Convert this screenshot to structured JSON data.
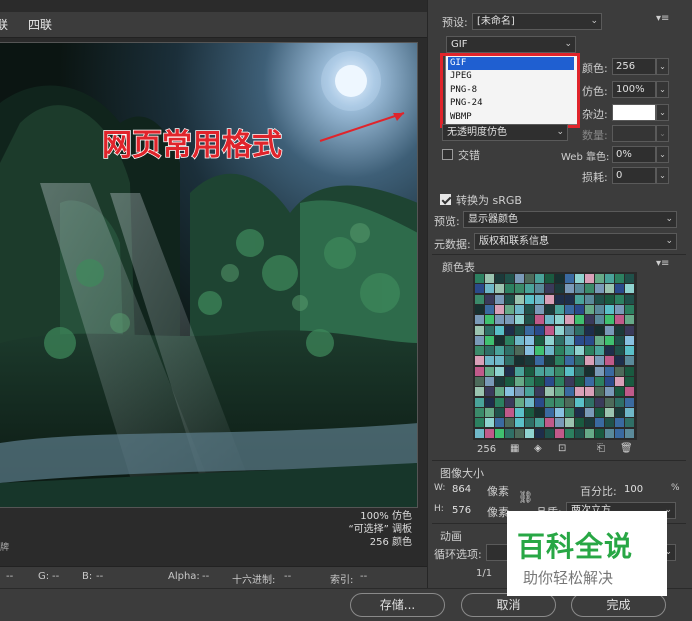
{
  "tabs": [
    "联",
    "四联"
  ],
  "annotation": {
    "text": "网页常用格式",
    "color": "#e0242b"
  },
  "image_info": [
    "100% 仿色",
    "“可选择” 调板",
    "256 颜色"
  ],
  "left_bottom_mark": "牌",
  "status": {
    "r": "--",
    "g_label": "G:",
    "g": "--",
    "b_label": "B:",
    "b": "--",
    "alpha_label": "Alpha:",
    "alpha": "--",
    "hex_label": "十六进制:",
    "hex": "--",
    "index_label": "索引:",
    "index": "--"
  },
  "actions": {
    "save": "存储...",
    "cancel": "取消",
    "done": "完成"
  },
  "preset": {
    "label": "预设:",
    "value": "[未命名]"
  },
  "format": {
    "selected": "GIF",
    "options": [
      "GIF",
      "JPEG",
      "PNG-8",
      "PNG-24",
      "WBMP"
    ]
  },
  "settings": {
    "colors_label": "颜色:",
    "colors_value": "256",
    "dither_label": "仿色:",
    "dither_value": "100%",
    "matte_label": "杂边:",
    "transparency_dither": "无透明度仿色",
    "amount_label": "数量:",
    "interlaced_label": "交错",
    "web_snap_label": "Web 靠色:",
    "web_snap_value": "0%",
    "lossy_label": "损耗:",
    "lossy_value": "0"
  },
  "convert_srgb": "转换为 sRGB",
  "preview": {
    "label": "预览:",
    "value": "显示器颜色"
  },
  "metadata": {
    "label": "元数据:",
    "value": "版权和联系信息"
  },
  "color_table": {
    "title": "颜色表",
    "count": "256"
  },
  "image_size": {
    "title": "图像大小",
    "w_label": "W:",
    "w_value": "864",
    "w_unit": "像素",
    "h_label": "H:",
    "h_value": "576",
    "h_unit": "像素",
    "percent_label": "百分比:",
    "percent_value": "100",
    "percent_unit": "%",
    "quality_label": "品质:",
    "quality_value": "两次立方"
  },
  "animation": {
    "title": "动画",
    "loop_label": "循环选项:",
    "frame": "1/1"
  },
  "watermark": {
    "title": "百科全说",
    "subtitle": "助你轻松解决"
  },
  "colors": {
    "panel": "#3c3c3c",
    "selection_blue": "#1f5fd1",
    "highlight_red": "#e0242b",
    "watermark_green": "#28a745"
  }
}
